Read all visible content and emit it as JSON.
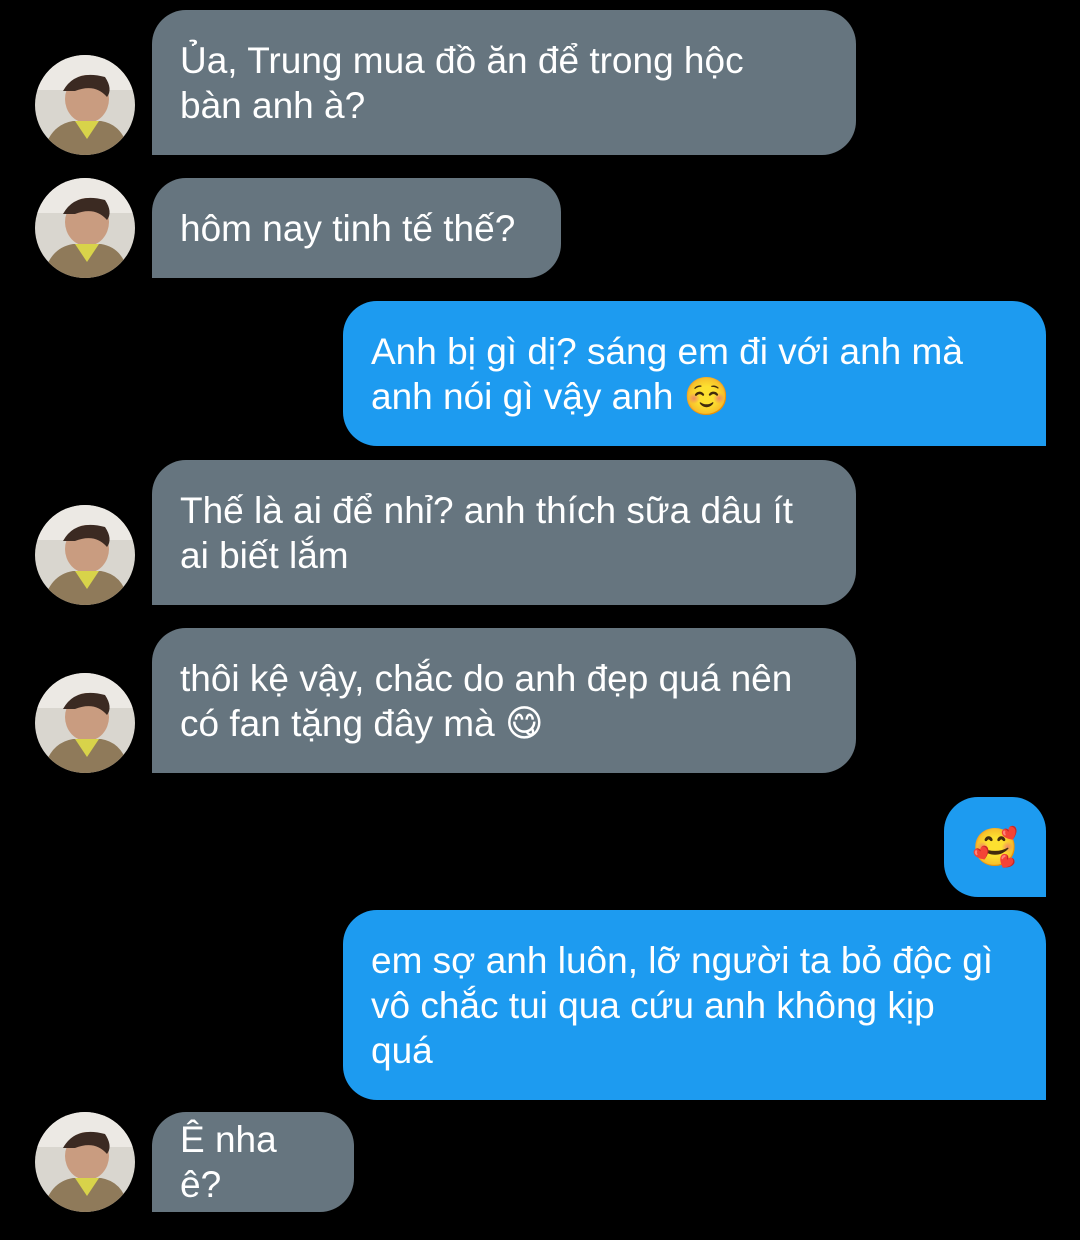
{
  "conversation": {
    "messages": [
      {
        "sender": "them",
        "text": "Ủa, Trung mua đồ ăn để trong hộc\nbàn anh à?"
      },
      {
        "sender": "them",
        "text": "hôm nay tinh tế thế?"
      },
      {
        "sender": "me",
        "text": "Anh bị gì dị? sáng em đi với anh mà\nanh nói gì vậy anh ☺️"
      },
      {
        "sender": "them",
        "text": "Thế là ai để nhỉ? anh thích sữa dâu ít\nai biết lắm"
      },
      {
        "sender": "them",
        "text": "thôi kệ vậy, chắc do anh đẹp quá nên\ncó fan tặng đây mà 😋"
      },
      {
        "sender": "me",
        "text": "🥰"
      },
      {
        "sender": "me",
        "text": "em sợ anh luôn, lỡ người ta bỏ độc gì\nvô chắc tui qua cứu anh không kịp\nquá"
      },
      {
        "sender": "them",
        "text": "Ê nha ê?"
      }
    ]
  },
  "colors": {
    "background": "#000000",
    "incoming_bubble": "#66757f",
    "outgoing_bubble": "#1d9bf0",
    "text": "#ffffff"
  },
  "icons": {
    "avatar": "profile-avatar"
  }
}
